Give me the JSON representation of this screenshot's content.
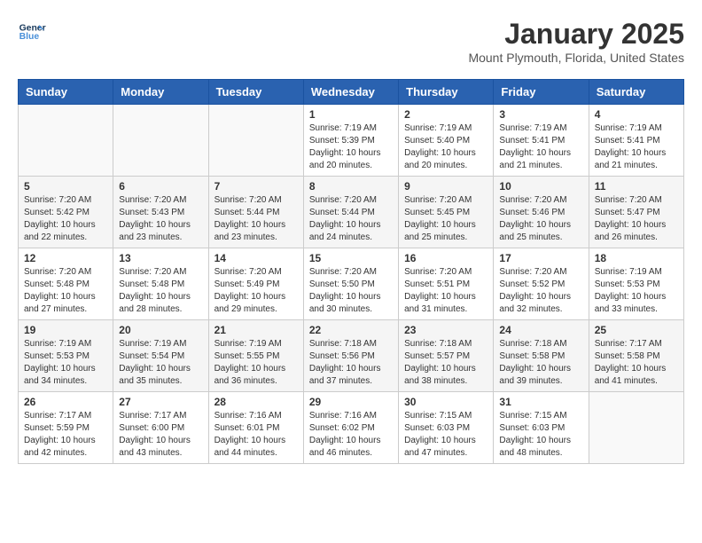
{
  "header": {
    "logo_line1": "General",
    "logo_line2": "Blue",
    "month": "January 2025",
    "location": "Mount Plymouth, Florida, United States"
  },
  "weekdays": [
    "Sunday",
    "Monday",
    "Tuesday",
    "Wednesday",
    "Thursday",
    "Friday",
    "Saturday"
  ],
  "weeks": [
    [
      {
        "day": "",
        "text": ""
      },
      {
        "day": "",
        "text": ""
      },
      {
        "day": "",
        "text": ""
      },
      {
        "day": "1",
        "text": "Sunrise: 7:19 AM\nSunset: 5:39 PM\nDaylight: 10 hours\nand 20 minutes."
      },
      {
        "day": "2",
        "text": "Sunrise: 7:19 AM\nSunset: 5:40 PM\nDaylight: 10 hours\nand 20 minutes."
      },
      {
        "day": "3",
        "text": "Sunrise: 7:19 AM\nSunset: 5:41 PM\nDaylight: 10 hours\nand 21 minutes."
      },
      {
        "day": "4",
        "text": "Sunrise: 7:19 AM\nSunset: 5:41 PM\nDaylight: 10 hours\nand 21 minutes."
      }
    ],
    [
      {
        "day": "5",
        "text": "Sunrise: 7:20 AM\nSunset: 5:42 PM\nDaylight: 10 hours\nand 22 minutes."
      },
      {
        "day": "6",
        "text": "Sunrise: 7:20 AM\nSunset: 5:43 PM\nDaylight: 10 hours\nand 23 minutes."
      },
      {
        "day": "7",
        "text": "Sunrise: 7:20 AM\nSunset: 5:44 PM\nDaylight: 10 hours\nand 23 minutes."
      },
      {
        "day": "8",
        "text": "Sunrise: 7:20 AM\nSunset: 5:44 PM\nDaylight: 10 hours\nand 24 minutes."
      },
      {
        "day": "9",
        "text": "Sunrise: 7:20 AM\nSunset: 5:45 PM\nDaylight: 10 hours\nand 25 minutes."
      },
      {
        "day": "10",
        "text": "Sunrise: 7:20 AM\nSunset: 5:46 PM\nDaylight: 10 hours\nand 25 minutes."
      },
      {
        "day": "11",
        "text": "Sunrise: 7:20 AM\nSunset: 5:47 PM\nDaylight: 10 hours\nand 26 minutes."
      }
    ],
    [
      {
        "day": "12",
        "text": "Sunrise: 7:20 AM\nSunset: 5:48 PM\nDaylight: 10 hours\nand 27 minutes."
      },
      {
        "day": "13",
        "text": "Sunrise: 7:20 AM\nSunset: 5:48 PM\nDaylight: 10 hours\nand 28 minutes."
      },
      {
        "day": "14",
        "text": "Sunrise: 7:20 AM\nSunset: 5:49 PM\nDaylight: 10 hours\nand 29 minutes."
      },
      {
        "day": "15",
        "text": "Sunrise: 7:20 AM\nSunset: 5:50 PM\nDaylight: 10 hours\nand 30 minutes."
      },
      {
        "day": "16",
        "text": "Sunrise: 7:20 AM\nSunset: 5:51 PM\nDaylight: 10 hours\nand 31 minutes."
      },
      {
        "day": "17",
        "text": "Sunrise: 7:20 AM\nSunset: 5:52 PM\nDaylight: 10 hours\nand 32 minutes."
      },
      {
        "day": "18",
        "text": "Sunrise: 7:19 AM\nSunset: 5:53 PM\nDaylight: 10 hours\nand 33 minutes."
      }
    ],
    [
      {
        "day": "19",
        "text": "Sunrise: 7:19 AM\nSunset: 5:53 PM\nDaylight: 10 hours\nand 34 minutes."
      },
      {
        "day": "20",
        "text": "Sunrise: 7:19 AM\nSunset: 5:54 PM\nDaylight: 10 hours\nand 35 minutes."
      },
      {
        "day": "21",
        "text": "Sunrise: 7:19 AM\nSunset: 5:55 PM\nDaylight: 10 hours\nand 36 minutes."
      },
      {
        "day": "22",
        "text": "Sunrise: 7:18 AM\nSunset: 5:56 PM\nDaylight: 10 hours\nand 37 minutes."
      },
      {
        "day": "23",
        "text": "Sunrise: 7:18 AM\nSunset: 5:57 PM\nDaylight: 10 hours\nand 38 minutes."
      },
      {
        "day": "24",
        "text": "Sunrise: 7:18 AM\nSunset: 5:58 PM\nDaylight: 10 hours\nand 39 minutes."
      },
      {
        "day": "25",
        "text": "Sunrise: 7:17 AM\nSunset: 5:58 PM\nDaylight: 10 hours\nand 41 minutes."
      }
    ],
    [
      {
        "day": "26",
        "text": "Sunrise: 7:17 AM\nSunset: 5:59 PM\nDaylight: 10 hours\nand 42 minutes."
      },
      {
        "day": "27",
        "text": "Sunrise: 7:17 AM\nSunset: 6:00 PM\nDaylight: 10 hours\nand 43 minutes."
      },
      {
        "day": "28",
        "text": "Sunrise: 7:16 AM\nSunset: 6:01 PM\nDaylight: 10 hours\nand 44 minutes."
      },
      {
        "day": "29",
        "text": "Sunrise: 7:16 AM\nSunset: 6:02 PM\nDaylight: 10 hours\nand 46 minutes."
      },
      {
        "day": "30",
        "text": "Sunrise: 7:15 AM\nSunset: 6:03 PM\nDaylight: 10 hours\nand 47 minutes."
      },
      {
        "day": "31",
        "text": "Sunrise: 7:15 AM\nSunset: 6:03 PM\nDaylight: 10 hours\nand 48 minutes."
      },
      {
        "day": "",
        "text": ""
      }
    ]
  ]
}
